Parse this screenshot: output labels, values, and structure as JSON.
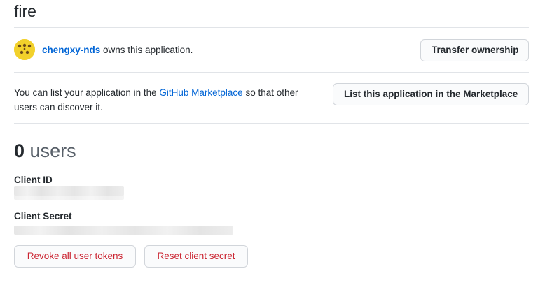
{
  "app": {
    "title": "fire"
  },
  "owner": {
    "username": "chengxy-nds",
    "suffix_text": " owns this application.",
    "transfer_button": "Transfer ownership"
  },
  "marketplace": {
    "text_before": "You can list your application in the ",
    "link_text": "GitHub Marketplace",
    "text_after": " so that other users can discover it.",
    "list_button": "List this application in the Marketplace"
  },
  "users": {
    "count": "0",
    "label": "users"
  },
  "credentials": {
    "client_id_label": "Client ID",
    "client_secret_label": "Client Secret"
  },
  "actions": {
    "revoke_button": "Revoke all user tokens",
    "reset_button": "Reset client secret"
  },
  "colors": {
    "link": "#0366d6",
    "danger": "#cb2431",
    "border": "#e1e4e8",
    "avatar_bg": "#f2d12b"
  }
}
